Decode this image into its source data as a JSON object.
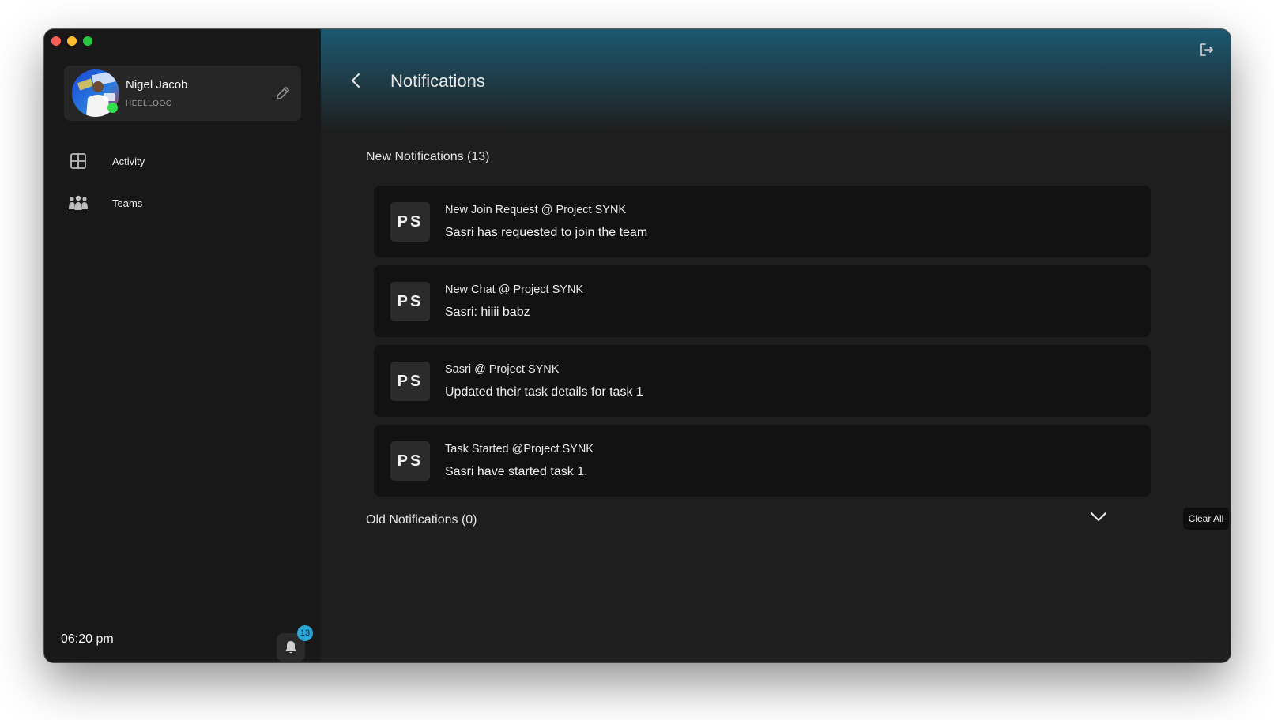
{
  "sidebar": {
    "profile": {
      "name": "Nigel Jacob",
      "status": "HEELLOOO"
    },
    "nav": [
      {
        "label": "Activity",
        "icon": "grid-icon"
      },
      {
        "label": "Teams",
        "icon": "team-icon"
      }
    ],
    "clock": "06:20 pm",
    "notification_badge": "13"
  },
  "header": {
    "title": "Notifications"
  },
  "new_section": {
    "title": "New Notifications (13)",
    "items": [
      {
        "initials": "PS",
        "title": "New Join Request @ Project SYNK",
        "body": "Sasri has requested to join the team"
      },
      {
        "initials": "PS",
        "title": "New Chat @ Project SYNK",
        "body": "Sasri: hiiii babz"
      },
      {
        "initials": "PS",
        "title": "Sasri @ Project SYNK",
        "body": "Updated their task details for task 1"
      },
      {
        "initials": "PS",
        "title": "Task Started @Project SYNK",
        "body": "Sasri have started task 1."
      }
    ]
  },
  "old_section": {
    "title": "Old Notifications (0)",
    "clear_label": "Clear All"
  },
  "colors": {
    "accent": "#2aa6d9",
    "online": "#2ee04b",
    "card_bg": "#121212",
    "sidebar_bg": "#181818"
  }
}
